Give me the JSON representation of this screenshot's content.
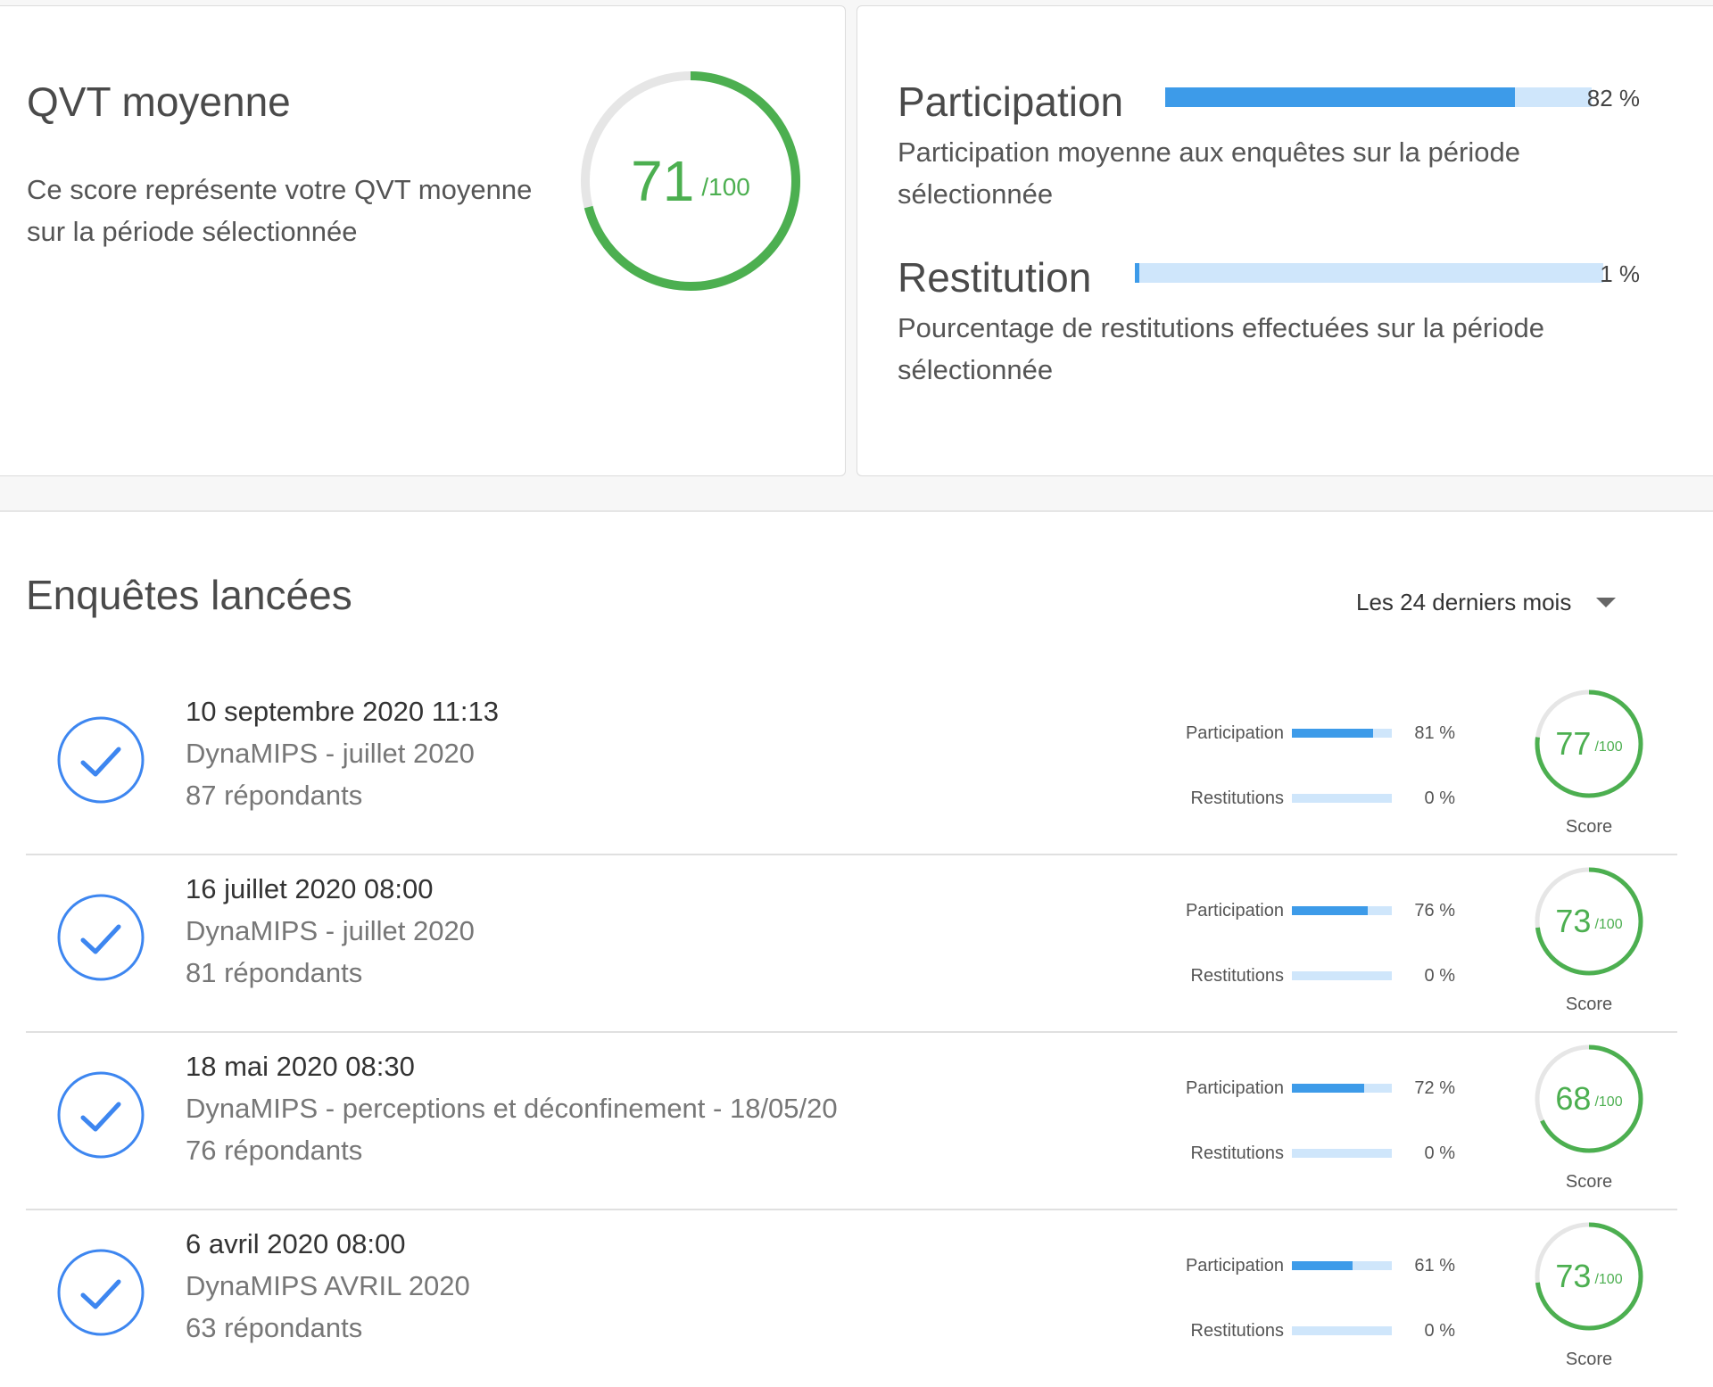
{
  "colors": {
    "green": "#4caf50",
    "gauge_track": "#e6e6e6",
    "bar_fill": "#3d9be9",
    "bar_track": "#cfe6fb",
    "check_blue": "#3d86f0"
  },
  "qvt": {
    "title": "QVT moyenne",
    "description": "Ce score représente votre QVT moyenne sur la période sélectionnée",
    "score": "71",
    "score_max": "/100",
    "score_value": 71
  },
  "participation": {
    "title": "Participation",
    "description": "Participation moyenne aux enquêtes sur la période sélectionnée",
    "pct_text": "82 %",
    "value": 82
  },
  "restitution": {
    "title": "Restitution",
    "description": "Pourcentage de restitutions effectuées sur la période sélectionnée",
    "pct_text": "1 %",
    "value": 1
  },
  "surveys": {
    "title": "Enquêtes lancées",
    "period_select": "Les 24 derniers mois",
    "participation_label": "Participation",
    "restitution_label": "Restitutions",
    "score_label": "Score",
    "score_max": "/100",
    "items": [
      {
        "date": "10 septembre 2020 11:13",
        "name": "DynaMIPS - juillet 2020",
        "respondents": "87 répondants",
        "participation_text": "81 %",
        "participation": 81,
        "restitution_text": "0 %",
        "restitution": 0,
        "score": "77",
        "score_value": 77
      },
      {
        "date": "16 juillet 2020 08:00",
        "name": "DynaMIPS - juillet 2020",
        "respondents": "81 répondants",
        "participation_text": "76 %",
        "participation": 76,
        "restitution_text": "0 %",
        "restitution": 0,
        "score": "73",
        "score_value": 73
      },
      {
        "date": "18 mai 2020 08:30",
        "name": "DynaMIPS - perceptions et déconfinement - 18/05/20",
        "respondents": "76 répondants",
        "participation_text": "72 %",
        "participation": 72,
        "restitution_text": "0 %",
        "restitution": 0,
        "score": "68",
        "score_value": 68
      },
      {
        "date": "6 avril 2020 08:00",
        "name": "DynaMIPS AVRIL 2020",
        "respondents": "63 répondants",
        "participation_text": "61 %",
        "participation": 61,
        "restitution_text": "0 %",
        "restitution": 0,
        "score": "73",
        "score_value": 73
      }
    ]
  }
}
